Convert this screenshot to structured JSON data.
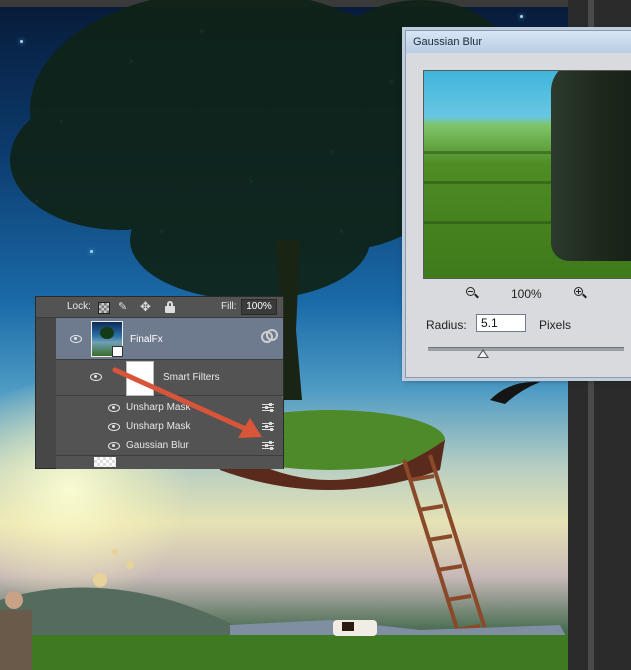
{
  "layers_panel": {
    "lock_label": "Lock:",
    "lock_icons": [
      "lock-transparent-pixels-icon",
      "lock-image-pixels-icon",
      "lock-position-icon",
      "lock-all-icon"
    ],
    "fill_label": "Fill:",
    "fill_value": "100%",
    "layers": [
      {
        "name": "FinalFx",
        "selected": true
      },
      {
        "name": "Smart Filters"
      }
    ],
    "filters": [
      {
        "name": "Unsharp Mask"
      },
      {
        "name": "Unsharp Mask"
      },
      {
        "name": "Gaussian Blur"
      }
    ]
  },
  "gaussian_blur_dialog": {
    "title": "Gaussian Blur",
    "zoom_value": "100%",
    "radius_label": "Radius:",
    "radius_value": "5.1",
    "radius_unit": "Pixels",
    "slider_level_fraction": 0.28
  },
  "colors": {
    "panel_bg": "#535353",
    "selected_layer": "#6e7a8e",
    "arrow": "#d8553a",
    "dialog_bg": "#d8dadd"
  }
}
